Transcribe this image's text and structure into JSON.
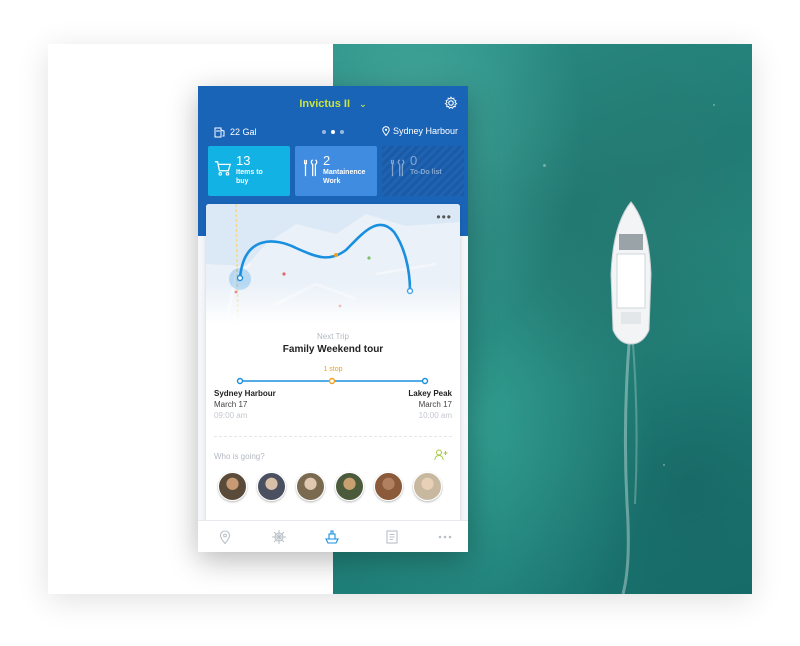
{
  "app": {
    "boat_name": "Invictus II",
    "fuel": "22 Gal",
    "location": "Sydney Harbour",
    "page_dots": 3,
    "active_dot": 1
  },
  "tiles": [
    {
      "count": "13",
      "label_line1": "Items to",
      "label_line2": "buy",
      "icon": "cart-icon",
      "color": "#13b2e4"
    },
    {
      "count": "2",
      "label_line1": "Mantainence",
      "label_line2": "Work",
      "icon": "tools-icon",
      "color": "#3f8ce0"
    },
    {
      "count": "0",
      "label_line1": "To-Do list",
      "label_line2": "",
      "icon": "tools-icon",
      "color": "#1a5aa6"
    }
  ],
  "trip": {
    "section_label": "Next Trip",
    "name": "Family Weekend tour",
    "stops": "1 stop",
    "from": {
      "place": "Sydney Harbour",
      "date": "March 17",
      "time": "09:00 am"
    },
    "to": {
      "place": "Lakey Peak",
      "date": "March 17",
      "time": "10:00 am"
    }
  },
  "who": {
    "label": "Who is going?",
    "avatars": [
      "#5a4a3a",
      "#4a5060",
      "#7a6a50",
      "#4a5a3a",
      "#8a5a3a",
      "#c8b8a0"
    ]
  },
  "tabbar": [
    "location-icon",
    "helm-icon",
    "boat-icon",
    "logbook-icon",
    "more-icon"
  ],
  "colors": {
    "header": "#1a64b8",
    "accent": "#c9e53b",
    "route": "#1a8fe0",
    "stop": "#f0a020"
  }
}
